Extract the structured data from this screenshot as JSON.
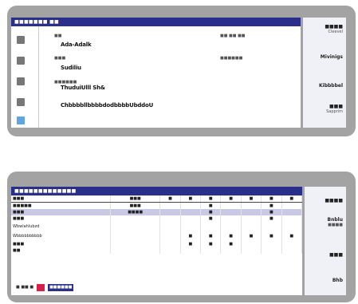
{
  "top_window": {
    "title": "■■■■■■■ ■■",
    "fields": [
      {
        "label": "■■",
        "value": "Ada-Adalk",
        "side_label": "■■ ■■ ■■"
      },
      {
        "label": "■■■",
        "value": "Sudiliu",
        "side_label": "■■■■■■"
      },
      {
        "label": "■■■■■■",
        "value": "ThuduiUlll  Sh&",
        "side_label": ""
      },
      {
        "label": "",
        "value": "ChbbbbllbbbbdodbbbbUbddoU",
        "side_label": ""
      }
    ],
    "right_items": [
      {
        "title": "■■■■",
        "sub": "Cleevel"
      },
      {
        "title": "Mivinigs",
        "sub": ""
      },
      {
        "title": "Kibbbbel",
        "sub": ""
      },
      {
        "title": "■■■",
        "sub": "Sapprim"
      }
    ]
  },
  "bottom_window": {
    "title": "■■■■■■■■■■■■■",
    "columns": [
      "■■■",
      "■■■",
      "■",
      "■",
      "■",
      "■",
      "■",
      "■",
      "■"
    ],
    "rows": [
      {
        "cells": [
          "■■■■■",
          "■■■",
          "",
          "",
          "■",
          "",
          "",
          "■",
          ""
        ],
        "selected": false
      },
      {
        "cells": [
          "■■■",
          "■■■■",
          "",
          "",
          "■",
          "",
          "",
          "■",
          ""
        ],
        "selected": true
      },
      {
        "cells": [
          "■■■",
          "",
          "",
          "",
          "■",
          "",
          "",
          "■",
          ""
        ],
        "selected": false
      },
      {
        "cells": [
          "Wbwlahlubzd",
          "",
          "",
          "",
          "",
          "",
          "",
          "",
          ""
        ],
        "selected": false
      },
      {
        "cells": [
          "Wbbbbbbbbbb",
          "",
          "",
          "■",
          "■",
          "■",
          "■",
          "■",
          "■"
        ],
        "selected": false
      },
      {
        "cells": [
          "■■■",
          "",
          "",
          "■",
          "■",
          "■",
          "",
          "",
          ""
        ],
        "selected": false
      },
      {
        "cells": [
          "■■",
          "",
          "",
          "",
          "",
          "",
          "",
          "",
          ""
        ],
        "selected": false
      }
    ],
    "right_items": [
      {
        "title": "■■■■",
        "sub": ""
      },
      {
        "title": "Bnblu",
        "sub": "■■■■"
      },
      {
        "title": "■■■",
        "sub": ""
      },
      {
        "title": "Bhb",
        "sub": ""
      }
    ],
    "footer": {
      "left": "■ ■■ ■",
      "red": "",
      "blue": "■■■■■■"
    }
  },
  "colors": {
    "titlebar": "#2b2f8c",
    "frame": "#a3a3a3",
    "selected_row": "#c9c9e6",
    "accent_red": "#d6204a",
    "icon_blue": "#5fa6e0"
  }
}
